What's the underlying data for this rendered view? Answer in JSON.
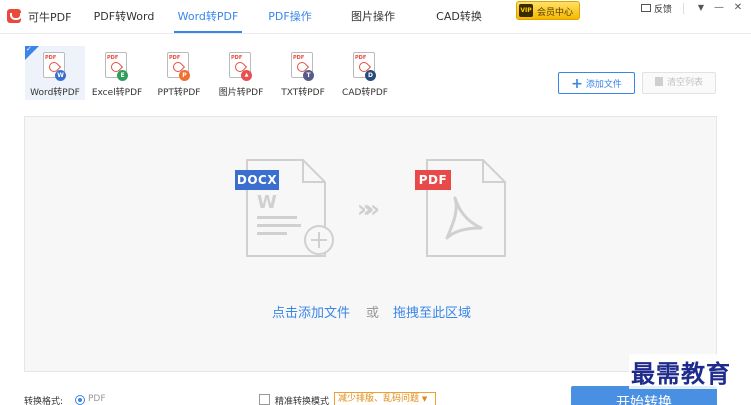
{
  "app": {
    "title": "可牛PDF"
  },
  "topnav": {
    "items": [
      {
        "label": "PDF转Word"
      },
      {
        "label": "Word转PDF"
      },
      {
        "label": "PDF操作"
      },
      {
        "label": "图片操作"
      },
      {
        "label": "CAD转换"
      }
    ],
    "active_index": 1
  },
  "vip": {
    "badge": "VIP",
    "label": "会员中心"
  },
  "window": {
    "feedback": "反馈",
    "menu": "▼",
    "minimize": "—",
    "close": "✕"
  },
  "tools": [
    {
      "label": "Word转PDF",
      "badge": "W",
      "color": "#3a6fd0"
    },
    {
      "label": "Excel转PDF",
      "badge": "E",
      "color": "#2e9e5b"
    },
    {
      "label": "PPT转PDF",
      "badge": "P",
      "color": "#f07030"
    },
    {
      "label": "图片转PDF",
      "badge": "▲",
      "color": "#e85050"
    },
    {
      "label": "TXT转PDF",
      "badge": "T",
      "color": "#5a5a8a"
    },
    {
      "label": "CAD转PDF",
      "badge": "D",
      "color": "#2a4a7a"
    }
  ],
  "actions": {
    "add_file": "添加文件",
    "clear_list": "清空列表"
  },
  "dropzone": {
    "source_label": "DOCX",
    "target_label": "PDF",
    "add_link": "点击添加文件",
    "or": "或",
    "drag_link": "拖拽至此区域",
    "colors": {
      "source": "#3a6fd0",
      "target": "#e84a4a",
      "link": "#3a86e8"
    }
  },
  "bottom": {
    "format_label": "转换格式:",
    "format_option": "PDF",
    "precise_label": "精准转换模式",
    "precise_tip": "减少排版、乱码问题",
    "start_button": "开始转换"
  },
  "watermark": "最需教育"
}
